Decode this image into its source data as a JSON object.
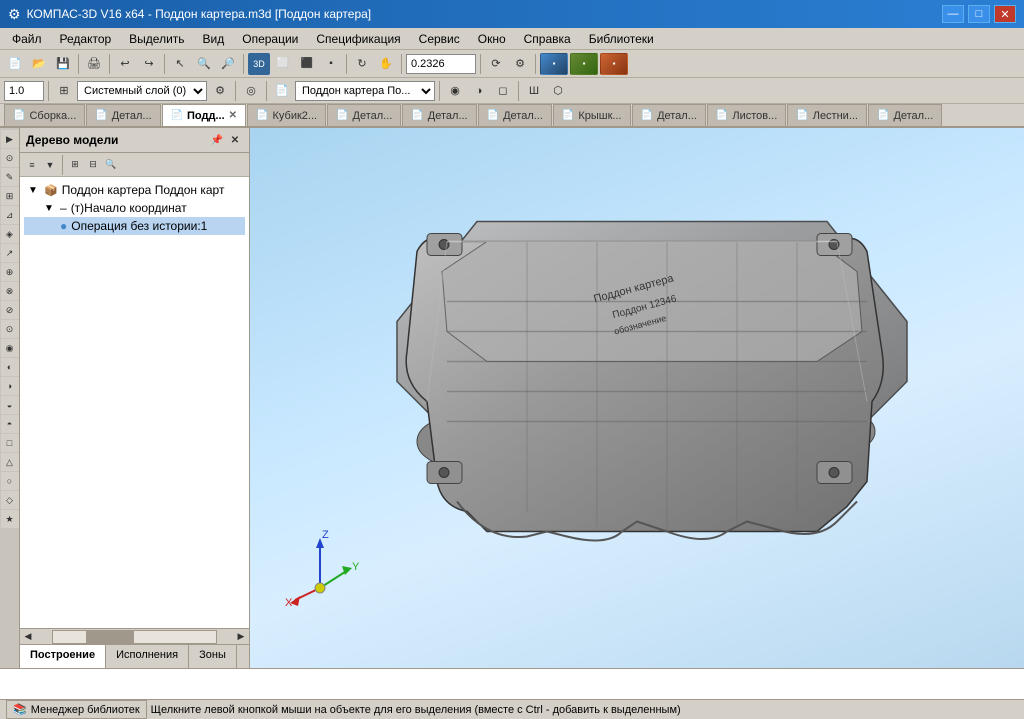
{
  "title": "КОМПАС-3D V16 x64 - Поддон картера.m3d [Поддон картера]",
  "title_icon": "⚙",
  "window_controls": {
    "minimize": "—",
    "maximize": "□",
    "close": "✕"
  },
  "menu": {
    "items": [
      "Файл",
      "Редактор",
      "Выделить",
      "Вид",
      "Операции",
      "Спецификация",
      "Сервис",
      "Окно",
      "Справка",
      "Библиотеки"
    ]
  },
  "toolbar1": {
    "zoom_value": "0.2326",
    "buttons": [
      "new",
      "open",
      "save",
      "print",
      "sep",
      "undo",
      "redo",
      "sep",
      "zoom_in",
      "zoom_out",
      "zoom_all"
    ]
  },
  "toolbar2": {
    "scale_value": "1.0",
    "layer_label": "Системный слой (0)",
    "doc_label": "Поддон картера По..."
  },
  "tabs": [
    {
      "label": "Сборка...",
      "active": false,
      "icon": "🔧"
    },
    {
      "label": "Детал...",
      "active": false,
      "icon": "📄"
    },
    {
      "label": "Подд...",
      "active": true,
      "icon": "📄"
    },
    {
      "label": "Кубик2...",
      "active": false,
      "icon": "📄"
    },
    {
      "label": "Детал...",
      "active": false,
      "icon": "📄"
    },
    {
      "label": "Детал...",
      "active": false,
      "icon": "📄"
    },
    {
      "label": "Детал...",
      "active": false,
      "icon": "📄"
    },
    {
      "label": "Крышк...",
      "active": false,
      "icon": "📄"
    },
    {
      "label": "Детал...",
      "active": false,
      "icon": "📄"
    },
    {
      "label": "Листов...",
      "active": false,
      "icon": "📄"
    },
    {
      "label": "Лестни...",
      "active": false,
      "icon": "📄"
    },
    {
      "label": "Детал...",
      "active": false,
      "icon": "📄"
    }
  ],
  "model_tree": {
    "title": "Дерево модели",
    "items": [
      {
        "level": 0,
        "label": "Поддон картера Поддон карт",
        "expanded": true,
        "icon": "box"
      },
      {
        "level": 1,
        "label": "(т)Начало координат",
        "expanded": true,
        "icon": "origin"
      },
      {
        "level": 1,
        "label": "Операция без истории:1",
        "expanded": false,
        "icon": "operation"
      }
    ]
  },
  "left_bottom_tabs": [
    "Построение",
    "Исполнения",
    "Зоны"
  ],
  "viewport": {
    "bg_color_top": "#a8d4f0",
    "bg_color_bottom": "#d8eeff"
  },
  "axis": {
    "x_color": "#cc2222",
    "y_color": "#22aa22",
    "z_color": "#2222cc"
  },
  "status_bar": {
    "message": "Щелкните левой кнопкой мыши на объекте для его выделения (вместе с Ctrl - добавить к выделенным)"
  },
  "bottom_bar": {
    "library_btn": "Менеджер библиотек"
  },
  "left_side_tools": [
    "▶",
    "⊙",
    "✎",
    "⊞",
    "⊿",
    "◈",
    "↗",
    "⊕",
    "⊗",
    "⊘",
    "⊙",
    "◉",
    "◐",
    "◑",
    "◒",
    "◓",
    "□",
    "△",
    "○",
    "◇",
    "★",
    "✦",
    "⬡",
    "⬢"
  ]
}
